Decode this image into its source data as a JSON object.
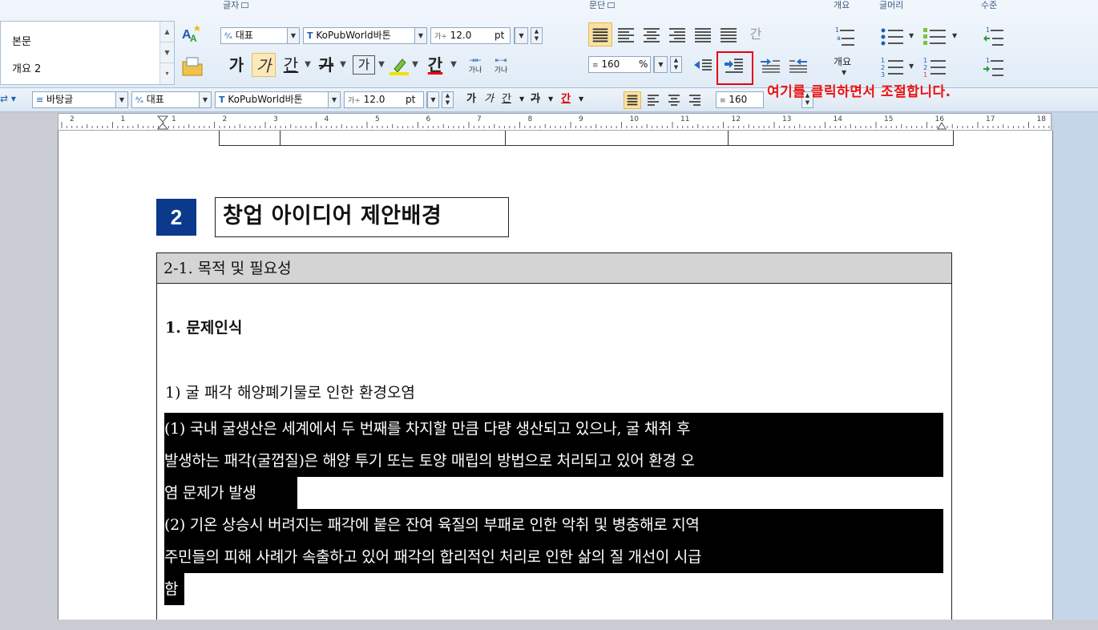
{
  "ribbon": {
    "group_titles": {
      "font": "글자",
      "paragraph": "문단",
      "outline": "개요",
      "bullet": "글머리",
      "level": "수준"
    },
    "style_list": {
      "items": [
        "본문",
        "개요 2"
      ]
    },
    "char_shape": {
      "value": "대표"
    },
    "font_face": {
      "value": "KoPubWorld바톤"
    },
    "font_size": {
      "value": "12.0",
      "unit": "pt"
    },
    "format_buttons": {
      "bold": "가",
      "italic": "가",
      "underline": "간",
      "strike": "가",
      "border_char": "가",
      "color_char": "간",
      "spacing_a": "가나",
      "spacing_b": "가나"
    },
    "line_spacing": {
      "value": "160",
      "unit": "%"
    },
    "outline_label": "개요",
    "aligned_text": "간"
  },
  "toolbar2": {
    "style": "바탕글",
    "char_shape": "대표",
    "font_face": "KoPubWorld바톤",
    "font_size": "12.0",
    "font_unit": "pt",
    "bold": "가",
    "italic": "가",
    "underline": "간",
    "strike": "가",
    "color": "간",
    "line_spacing": "160",
    "line_unit": "%"
  },
  "annotation": "여기를 클릭하면서 조절합니다.",
  "ruler": {
    "labels": [
      "2",
      "1",
      "1",
      "2",
      "3",
      "4",
      "5",
      "6",
      "7",
      "8",
      "9",
      "10",
      "11",
      "12",
      "13",
      "14",
      "15",
      "16",
      "17",
      "18"
    ]
  },
  "document": {
    "section_number": "2",
    "section_title": "창업 아이디어 제안배경",
    "subsection": "2-1. 목적 및 필요성",
    "heading": "1. 문제인식",
    "item": "1) 굴 패각 해양폐기물로 인한 환경오염",
    "highlight_lines": [
      "(1) 국내 굴생산은 세계에서 두 번째를 차지할 만큼 다량 생산되고 있으나, 굴 채취 후",
      "발생하는 패각(굴껍질)은 해양 투기 또는 토양 매립의 방법으로 처리되고 있어 환경 오",
      "염 문제가 발생",
      "(2) 기온 상승시 버려지는 패각에 붙은 잔여 육질의 부패로 인한 악취 및 병충해로 지역",
      "주민들의 피해 사례가 속출하고 있어 패각의 합리적인 처리로 인한 삶의 질 개선이 시급",
      "함"
    ]
  },
  "colors": {
    "section_badge": "#0b3a8c",
    "annotation": "#ee1111",
    "highlight_box": "#e60012"
  }
}
